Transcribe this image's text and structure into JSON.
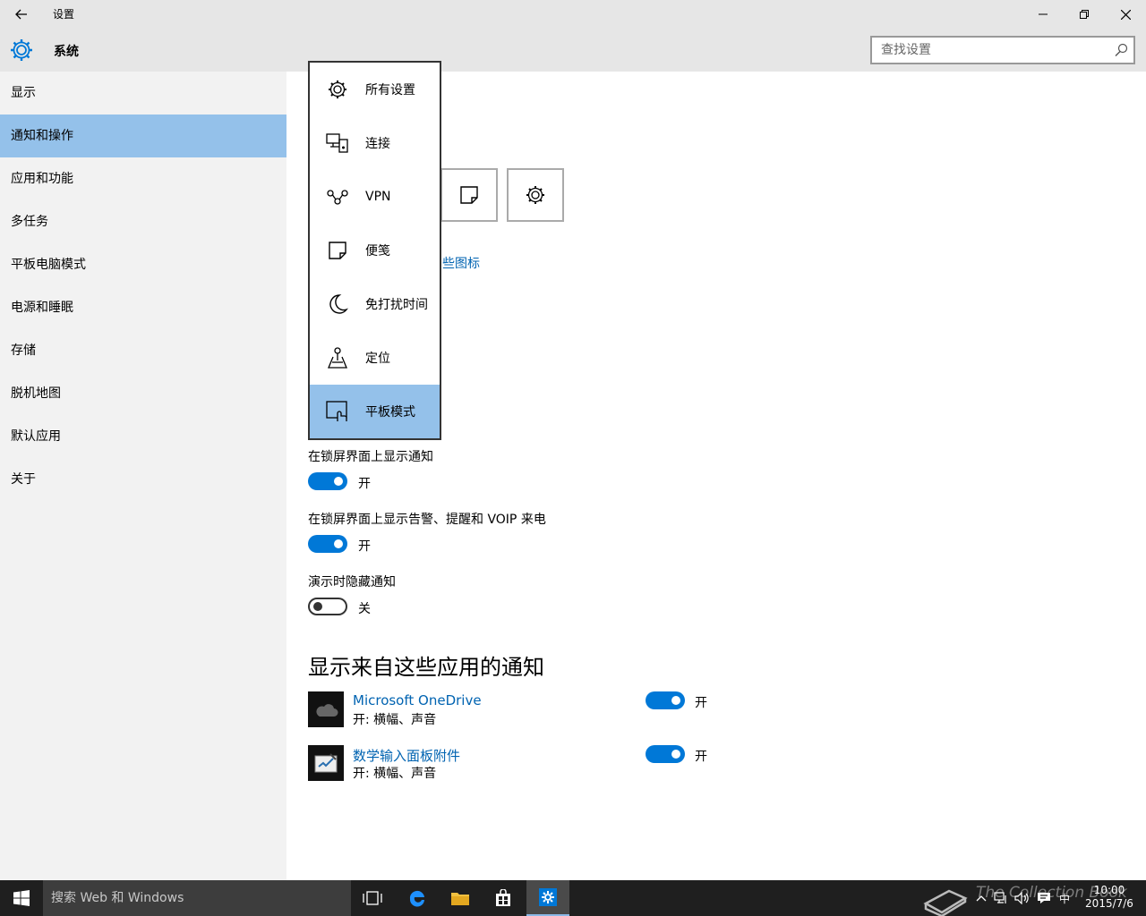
{
  "window": {
    "title": "设置",
    "minimize": "minimize",
    "restore": "restore",
    "close": "close"
  },
  "header": {
    "section": "系统",
    "search_placeholder": "查找设置"
  },
  "sidebar": {
    "items": [
      {
        "label": "显示",
        "active": false
      },
      {
        "label": "通知和操作",
        "active": true
      },
      {
        "label": "应用和功能",
        "active": false
      },
      {
        "label": "多任务",
        "active": false
      },
      {
        "label": "平板电脑模式",
        "active": false
      },
      {
        "label": "电源和睡眠",
        "active": false
      },
      {
        "label": "存储",
        "active": false
      },
      {
        "label": "脱机地图",
        "active": false
      },
      {
        "label": "默认应用",
        "active": false
      },
      {
        "label": "关于",
        "active": false
      }
    ]
  },
  "main": {
    "icon_link_partial": "些图标",
    "settings": [
      {
        "label": "在锁屏界面上显示通知",
        "state": "开",
        "on": true
      },
      {
        "label": "在锁屏界面上显示告警、提醒和 VOIP 来电",
        "state": "开",
        "on": true
      },
      {
        "label": "演示时隐藏通知",
        "state": "关",
        "on": false
      }
    ],
    "apps_title": "显示来自这些应用的通知",
    "apps": [
      {
        "name": "Microsoft OneDrive",
        "sub": "开: 横幅、声音",
        "state": "开"
      },
      {
        "name": "数学输入面板附件",
        "sub": "开: 横幅、声音",
        "state": "开"
      }
    ]
  },
  "dropdown": {
    "items": [
      {
        "label": "所有设置",
        "icon": "gear-icon"
      },
      {
        "label": "连接",
        "icon": "connect-icon"
      },
      {
        "label": "VPN",
        "icon": "vpn-icon"
      },
      {
        "label": "便笺",
        "icon": "note-icon"
      },
      {
        "label": "免打扰时间",
        "icon": "moon-icon"
      },
      {
        "label": "定位",
        "icon": "location-icon"
      },
      {
        "label": "平板模式",
        "icon": "tablet-mode-icon",
        "selected": true
      }
    ]
  },
  "taskbar": {
    "search_text": "搜索 Web 和 Windows",
    "ime": "中",
    "time": "10:00",
    "date": "2015/7/6",
    "watermark": "The Collection Book"
  },
  "colors": {
    "accent": "#0078d7",
    "selected": "#94c1ea",
    "link": "#0063b1"
  }
}
